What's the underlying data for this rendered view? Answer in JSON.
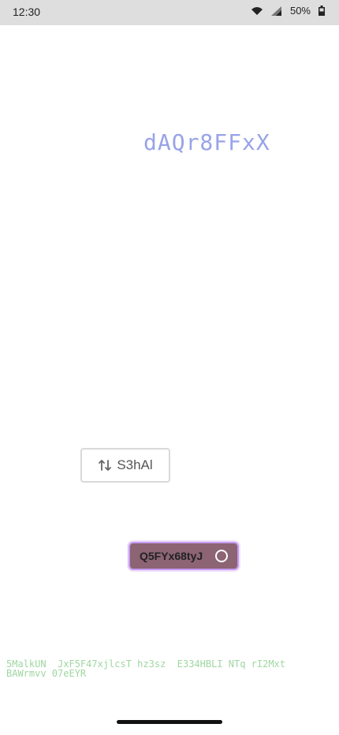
{
  "status_bar": {
    "time": "12:30",
    "battery": "50%",
    "wifi_icon": "wifi-icon",
    "signal_icon": "signal-icon",
    "battery_icon": "battery-icon"
  },
  "main": {
    "title": "dAQr8FFxX",
    "outline_button": {
      "icon": "swap-vertical-icon",
      "label": "S3hAl"
    },
    "filled_button": {
      "label": "Q5FYx68tyJ",
      "icon": "circle-icon"
    }
  },
  "footer": {
    "text": "5MalkUN  JxF5F47xjlcsT hz3sz  E334HBLI NTq rI2Mxt\nBAWrmvv 07eEYR"
  },
  "colors": {
    "title": "#98a3e8",
    "filled_button_bg": "#8c6474",
    "filled_button_border": "#c59bf0",
    "footer_text": "#9fd7a1",
    "status_bar_bg": "#dedede"
  }
}
